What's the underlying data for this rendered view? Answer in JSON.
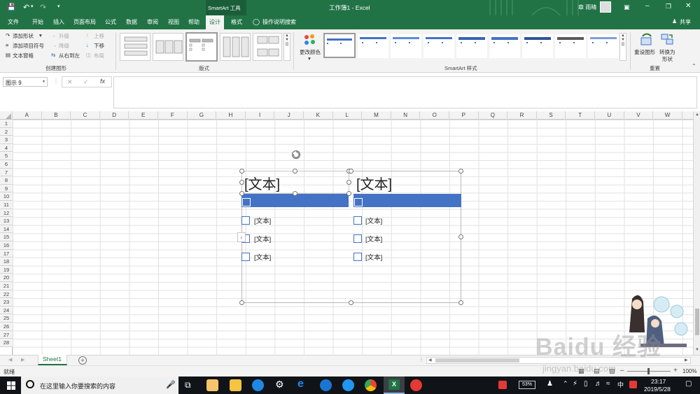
{
  "titlebar": {
    "tool_context": "SmartArt 工具",
    "title": "工作簿1 - Excel",
    "user": "章 雨晴"
  },
  "tabs": [
    "文件",
    "开始",
    "插入",
    "页面布局",
    "公式",
    "数据",
    "审阅",
    "视图",
    "帮助",
    "设计",
    "格式"
  ],
  "active_tab": "设计",
  "tell_me": "操作说明搜索",
  "share": "共享",
  "ribbon": {
    "create": {
      "add_shape": "添加形状",
      "add_bullet": "添加项目符号",
      "text_pane": "文本窗格",
      "promote": "升级",
      "demote": "降级",
      "right_to_left": "从右到左",
      "move_up": "上移",
      "move_down": "下移",
      "layout": "布局",
      "group_label": "创建图形"
    },
    "layouts_label": "版式",
    "change_colors": "更改颜色",
    "styles_label": "SmartArt 样式",
    "reset": {
      "reset_graphic": "重设图形",
      "convert_line1": "转换为",
      "convert_line2": "形状",
      "group_label": "重置"
    }
  },
  "formula_bar": {
    "name_box": "图示 9",
    "fx": "fx"
  },
  "columns": [
    "A",
    "B",
    "C",
    "D",
    "E",
    "F",
    "G",
    "H",
    "I",
    "J",
    "K",
    "L",
    "M",
    "N",
    "O",
    "P",
    "Q",
    "R",
    "S",
    "T",
    "U",
    "V",
    "W"
  ],
  "rows": [
    "1",
    "2",
    "3",
    "4",
    "5",
    "6",
    "7",
    "8",
    "9",
    "10",
    "11",
    "12",
    "13",
    "14",
    "15",
    "16",
    "17",
    "18",
    "19",
    "20",
    "21",
    "22",
    "23",
    "24",
    "25",
    "26",
    "27",
    "28"
  ],
  "smartart": {
    "col1_title": "[文本]",
    "col2_title": "[文本]",
    "col1_items": [
      "[文本]",
      "[文本]",
      "[文本]"
    ],
    "col2_items": [
      "[文本]",
      "[文本]",
      "[文本]"
    ],
    "expand_arrow": "‹"
  },
  "sheet_tab": "Sheet1",
  "add_sheet": "+",
  "status": {
    "ready": "就绪",
    "zoom": "100%"
  },
  "taskbar": {
    "search_placeholder": "在这里输入你要搜索的内容",
    "battery": "53%",
    "ime": "中",
    "time": "23:17",
    "date": "2019/5/28"
  },
  "watermark": {
    "brand": "Baidu 经验",
    "url": "jingyan.baidu.com"
  },
  "colors": {
    "excel_green": "#217346",
    "smartart_blue": "#4472c4",
    "taskbar": "#101418"
  }
}
